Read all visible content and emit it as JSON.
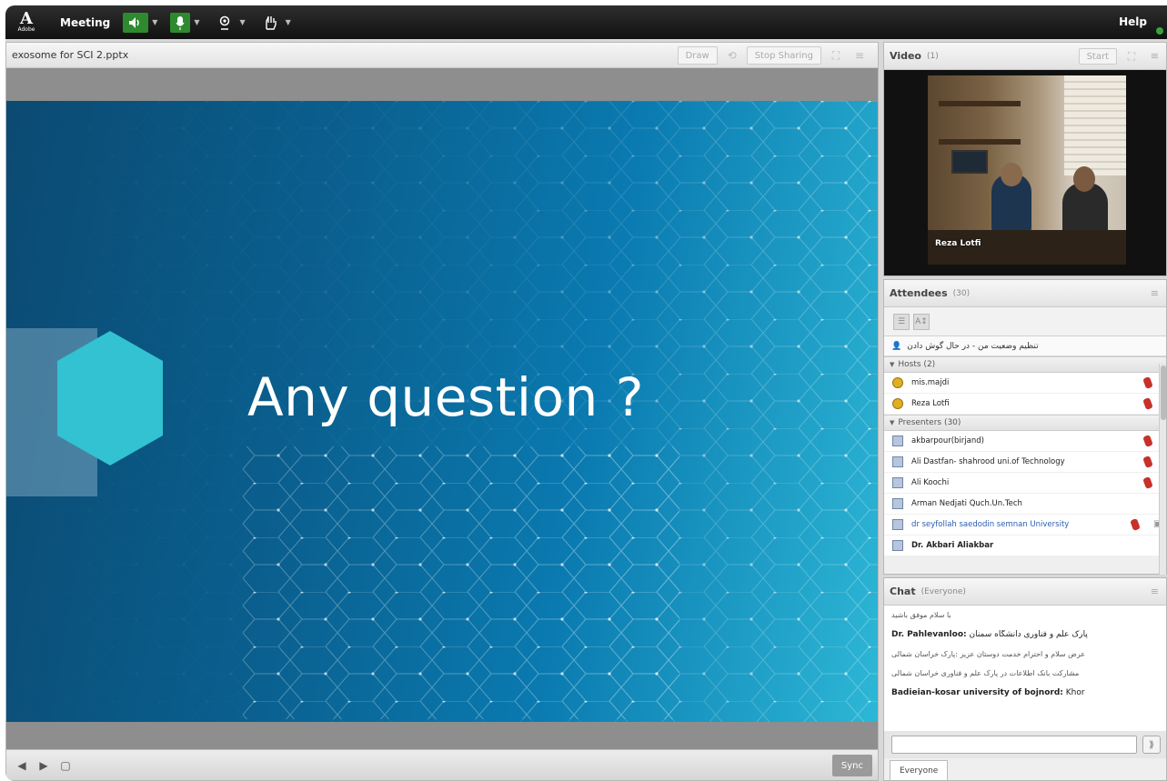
{
  "topbar": {
    "logo_text": "Adobe",
    "menu_label": "Meeting",
    "help_label": "Help"
  },
  "share": {
    "title": "exosome for SCI 2.pptx",
    "draw_label": "Draw",
    "stop_sharing_label": "Stop Sharing",
    "slide_text": "Any question ?",
    "sync_label": "Sync"
  },
  "video": {
    "title": "Video",
    "count": "(1)",
    "start_label": "Start",
    "participant_name": "Reza Lotfi"
  },
  "attendees": {
    "title": "Attendees",
    "count": "(30)",
    "status_text": "تنظیم وضعیت من - در حال گوش دادن",
    "groups": [
      {
        "label": "Hosts (2)",
        "members": [
          "mis.majdi",
          "Reza Lotfi"
        ]
      },
      {
        "label": "Presenters (30)",
        "members": [
          "akbarpour(birjand)",
          "Ali Dastfan- shahrood uni.of Technology",
          "Ali Koochi",
          "Arman Nedjati Quch.Un.Tech",
          "dr seyfollah saedodin semnan University",
          "Dr. Akbari Aliakbar"
        ]
      }
    ]
  },
  "chat": {
    "title": "Chat",
    "scope": "(Everyone)",
    "lines": [
      {
        "sender": "",
        "text": "با سلام موفق باشید"
      },
      {
        "sender": "Dr. Pahlevanloo:",
        "text": "پارک علم و فناوری دانشگاه سمنان"
      },
      {
        "sender": "",
        "text": "عرض سلام و احترام خدمت دوستان عزیز :پارک خراسان شمالی"
      },
      {
        "sender": "",
        "text": "مشارکت بانک اطلاعات در پارک علم و فناوری خراسان شمالی"
      },
      {
        "sender": "Badieian-kosar university of bojnord:",
        "text": "Khor"
      }
    ],
    "tab_label": "Everyone"
  },
  "colors": {
    "topbar": "#1a1a1a",
    "slide_dark": "#0b4a72",
    "slide_light": "#2db7d6",
    "mic_red": "#c8302a",
    "link_blue": "#2a5db0"
  }
}
